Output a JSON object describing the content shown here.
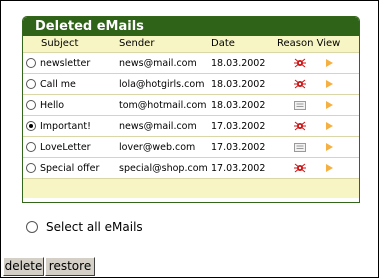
{
  "panel": {
    "title": "Deleted eMails"
  },
  "columns": {
    "subject": "Subject",
    "sender": "Sender",
    "date": "Date",
    "reason_view": "Reason View"
  },
  "emails": [
    {
      "subject": "newsletter",
      "sender": "news@mail.com",
      "date": "18.03.2002",
      "reason_icon": "virus-icon",
      "selected": false
    },
    {
      "subject": "Call me",
      "sender": "lola@hotgirls.com",
      "date": "18.03.2002",
      "reason_icon": "virus-icon",
      "selected": false
    },
    {
      "subject": "Hello",
      "sender": "tom@hotmail.com",
      "date": "18.03.2002",
      "reason_icon": "spam-icon",
      "selected": false
    },
    {
      "subject": "Important!",
      "sender": "news@mail.com",
      "date": "17.03.2002",
      "reason_icon": "virus-icon",
      "selected": true
    },
    {
      "subject": "LoveLetter",
      "sender": "lover@web.com",
      "date": "17.03.2002",
      "reason_icon": "spam-icon",
      "selected": false
    },
    {
      "subject": "Special offer",
      "sender": "special@shop.com",
      "date": "17.03.2002",
      "reason_icon": "virus-icon",
      "selected": false
    }
  ],
  "select_all": {
    "label": "Select all eMails",
    "selected": false
  },
  "buttons": {
    "delete": "delete",
    "restore": "restore"
  },
  "colors": {
    "header_green": "#2e6318",
    "header_row": "#f7f5c4",
    "virus_red": "#cc1111",
    "view_arrow": "#f5b041"
  }
}
